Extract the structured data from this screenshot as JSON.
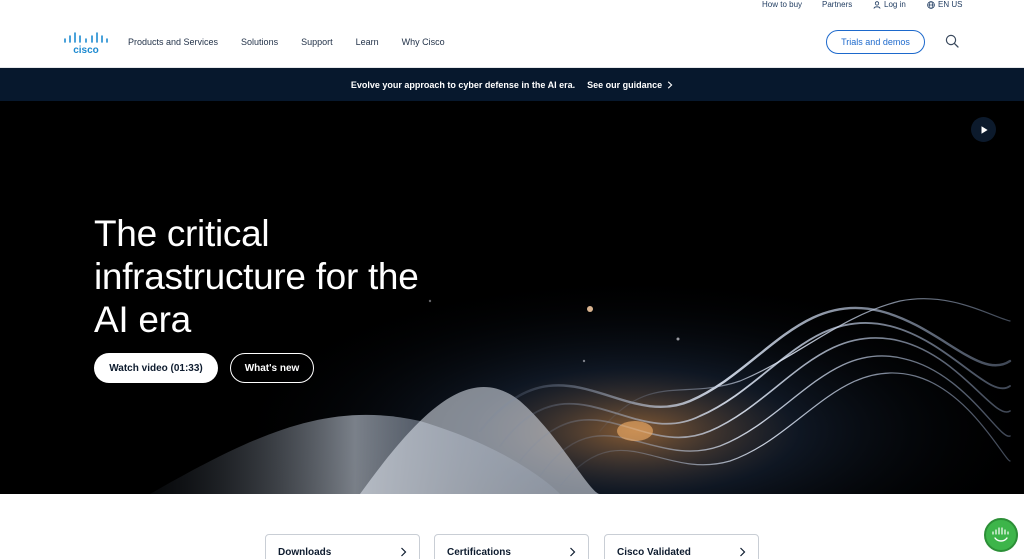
{
  "utility": {
    "how_to_buy": "How to buy",
    "partners": "Partners",
    "log_in": "Log in",
    "locale": "EN US"
  },
  "header": {
    "logo_text": "cisco",
    "nav": [
      "Products and Services",
      "Solutions",
      "Support",
      "Learn",
      "Why Cisco"
    ],
    "trials_label": "Trials and demos"
  },
  "banner": {
    "message": "Evolve your approach to cyber defense in the AI era.",
    "link_label": "See our guidance"
  },
  "hero": {
    "headline": "The critical infrastructure for the AI era",
    "watch_label": "Watch video (01:33)",
    "whats_new_label": "What's new"
  },
  "cards": [
    {
      "label": "Downloads"
    },
    {
      "label": "Certifications"
    },
    {
      "label": "Cisco Validated"
    }
  ],
  "colors": {
    "brand_blue": "#1d69cc",
    "banner_bg": "#07182d",
    "chat_green": "#3db54a"
  }
}
